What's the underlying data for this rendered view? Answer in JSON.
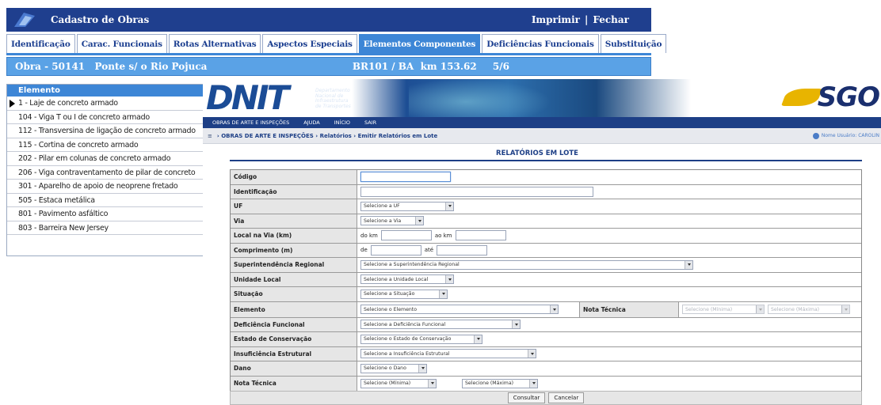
{
  "cadastro": {
    "title": "Cadastro de Obras",
    "actions": [
      "Imprimir",
      "|",
      "Fechar"
    ],
    "tabs": [
      {
        "label": "Identificação",
        "active": false
      },
      {
        "label": "Carac. Funcionais",
        "active": false
      },
      {
        "label": "Rotas Alternativas",
        "active": false
      },
      {
        "label": "Aspectos Especiais",
        "active": false
      },
      {
        "label": "Elementos Componentes",
        "active": true
      },
      {
        "label": "Deficiências Funcionais",
        "active": false
      },
      {
        "label": "Substituição",
        "active": false
      }
    ],
    "obra": "Obra - 50141   Ponte s/ o Rio Pojuca",
    "rodovia": "BR101 / BA  km 153.62",
    "page": "5/6",
    "elementos_header": "Elemento",
    "elementos": [
      "1 - Laje de concreto armado",
      "104 - Viga T ou I de concreto armado",
      "112 - Transversina de ligação de concreto armado",
      "115 - Cortina de concreto armado",
      "202 - Pilar em colunas de concreto armado",
      "206 - Viga contraventamento de pilar de concreto",
      "301 - Aparelho de apoio de neoprene fretado",
      "505 - Estaca metálica",
      "801 - Pavimento asfáltico",
      "803 - Barreira New Jersey"
    ],
    "colors": {
      "titlebar": "#1f3f8e",
      "tab_active": "#3d86d6",
      "obra_bar": "#5aa2e6"
    }
  },
  "dnit": {
    "logo": "DNIT",
    "logo_sub": [
      "Departamento",
      "Nacional de",
      "Infraestrutura",
      "de Transportes"
    ],
    "sgo_logo": "SGO",
    "menu": [
      "OBRAS DE ARTE E INSPEÇÕES",
      "AJUDA",
      "INÍCIO",
      "SAIR"
    ],
    "breadcrumb": {
      "home": "≡",
      "path": "› OBRAS DE ARTE E INSPEÇÕES › Relatórios › Emitir Relatórios em Lote"
    },
    "user": "Nome Usuário: CAROLIN",
    "form_title": "RELATÓRIOS EM LOTE",
    "fields": {
      "codigo": "Código",
      "identificacao": "Identificação",
      "uf": {
        "label": "UF",
        "value": "Selecione a UF"
      },
      "via": {
        "label": "Via",
        "value": "Selecione a Via"
      },
      "local": {
        "label": "Local na Via (km)",
        "from": "do km",
        "to": "ao km"
      },
      "comprimento": {
        "label": "Comprimento (m)",
        "from": "de",
        "to": "até"
      },
      "superintendencia": {
        "label": "Superintendência Regional",
        "value": "Selecione a Superintendência Regional"
      },
      "unidade": {
        "label": "Unidade Local",
        "value": "Selecione a Unidade Local"
      },
      "situacao": {
        "label": "Situação",
        "value": "Selecione a Situação"
      },
      "elemento": {
        "label": "Elemento",
        "value": "Selecione o Elemento",
        "nota_label": "Nota Técnica",
        "nota_min": "Selecione (Mínima)",
        "nota_max": "Selecione (Máxima)"
      },
      "deficiencia": {
        "label": "Deficiência Funcional",
        "value": "Selecione a Deficiência Funcional"
      },
      "estado": {
        "label": "Estado de Conservação",
        "value": "Selecione o Estado de Conservação"
      },
      "insuficiencia": {
        "label": "Insuficiência Estrutural",
        "value": "Selecione a Insuficiência Estrutural"
      },
      "dano": {
        "label": "Dano",
        "value": "Selecione o Dano"
      },
      "nota": {
        "label": "Nota Técnica",
        "min": "Selecione (Mínima)",
        "max": "Selecione (Máxima)"
      }
    },
    "buttons": {
      "consultar": "Consultar",
      "cancelar": "Cancelar"
    },
    "colors": {
      "menubar": "#1d3f86",
      "title": "#1d3f86",
      "label_bg": "#e6e6e6"
    }
  }
}
